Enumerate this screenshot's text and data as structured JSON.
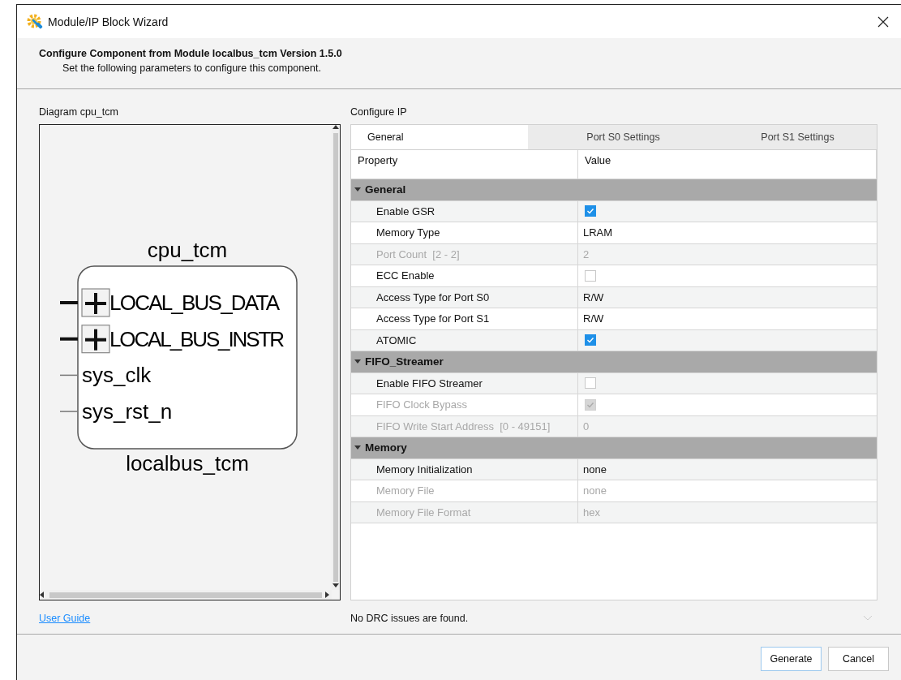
{
  "window": {
    "title": "Module/IP Block Wizard"
  },
  "header": {
    "title": "Configure Component from Module localbus_tcm Version 1.5.0",
    "subtitle": "Set the following parameters to configure this component."
  },
  "diagram": {
    "label": "Diagram cpu_tcm",
    "instance": "cpu_tcm",
    "module": "localbus_tcm",
    "ports": [
      {
        "name": "LOCAL_BUS_DATA",
        "kind": "bus"
      },
      {
        "name": "LOCAL_BUS_INSTR",
        "kind": "bus"
      },
      {
        "name": "sys_clk",
        "kind": "wire"
      },
      {
        "name": "sys_rst_n",
        "kind": "wire"
      }
    ]
  },
  "user_guide": "User Guide",
  "configure": {
    "label": "Configure IP",
    "tabs": [
      {
        "label": "General",
        "selected": true
      },
      {
        "label": "Port S0 Settings",
        "selected": false
      },
      {
        "label": "Port S1 Settings",
        "selected": false
      }
    ],
    "columns": [
      "Property",
      "Value"
    ],
    "sections": [
      {
        "label": "General",
        "expanded": true,
        "children": [
          {
            "kind": "checkbox",
            "label": "Enable GSR",
            "checked": true,
            "disabled": false
          },
          {
            "kind": "text",
            "label": "Memory Type",
            "value": "LRAM",
            "disabled": false
          },
          {
            "kind": "text",
            "label": "Port Count  [2 - 2]",
            "value": "2",
            "disabled": true
          },
          {
            "kind": "checkbox",
            "label": "ECC Enable",
            "checked": false,
            "disabled": false
          },
          {
            "kind": "text",
            "label": "Access Type for Port S0",
            "value": "R/W",
            "disabled": false
          },
          {
            "kind": "text",
            "label": "Access Type for Port S1",
            "value": "R/W",
            "disabled": false
          },
          {
            "kind": "checkbox",
            "label": "ATOMIC",
            "checked": true,
            "disabled": false
          }
        ]
      },
      {
        "label": "FIFO_Streamer",
        "expanded": true,
        "children": [
          {
            "kind": "checkbox",
            "label": "Enable FIFO Streamer",
            "checked": false,
            "disabled": false
          },
          {
            "kind": "checkbox",
            "label": "FIFO Clock Bypass",
            "checked": true,
            "disabled": true
          },
          {
            "kind": "text",
            "label": "FIFO Write Start Address  [0 - 49151]",
            "value": "0",
            "disabled": true
          }
        ]
      },
      {
        "label": "Memory",
        "expanded": true,
        "children": [
          {
            "kind": "text",
            "label": "Memory Initialization",
            "value": "none",
            "disabled": false
          },
          {
            "kind": "text",
            "label": "Memory File",
            "value": "none",
            "disabled": true
          },
          {
            "kind": "text",
            "label": "Memory File Format",
            "value": "hex",
            "disabled": true
          }
        ]
      }
    ]
  },
  "status": "No DRC issues are found.",
  "buttons": [
    {
      "label": "Generate",
      "focused": true
    },
    {
      "label": "Cancel",
      "focused": false
    }
  ]
}
